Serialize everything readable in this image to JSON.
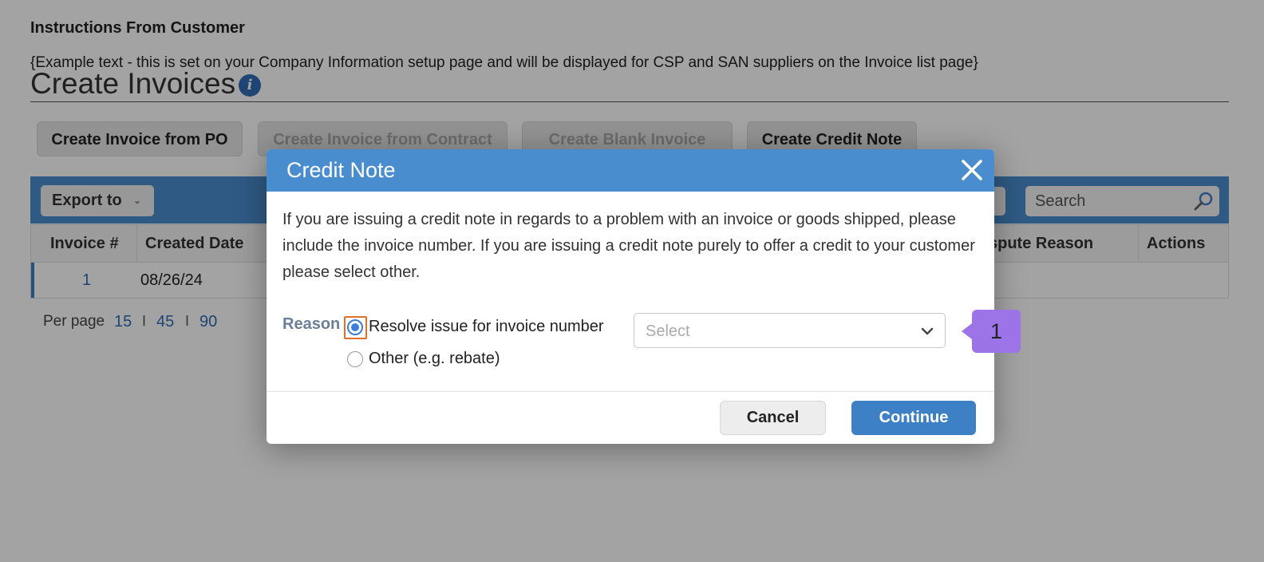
{
  "page": {
    "instructions_title": "Instructions From Customer",
    "instructions_text": "{Example text - this is set on your Company Information setup page and will be displayed for CSP and SAN suppliers on the Invoice list page}",
    "title": "Create Invoices",
    "info_icon_glyph": "i"
  },
  "toolbar": {
    "create_from_po": "Create Invoice from PO",
    "create_from_contract": "Create Invoice from Contract",
    "create_blank": "Create Blank Invoice",
    "create_credit_note": "Create Credit Note"
  },
  "table": {
    "export_label": "Export to",
    "search_placeholder": "Search",
    "columns": [
      "Invoice #",
      "Created Date",
      "spute Reason",
      "Actions"
    ],
    "rows": [
      {
        "invoice_no": "1",
        "created_date": "08/26/24"
      }
    ]
  },
  "pagination": {
    "label": "Per page",
    "options": [
      "15",
      "45",
      "90"
    ],
    "separator": "I"
  },
  "modal": {
    "title": "Credit Note",
    "description": "If you are issuing a credit note in regards to a problem with an invoice or goods shipped, please include the invoice number. If you are issuing a credit note purely to offer a credit to your customer please select other.",
    "reason_label": "Reason",
    "options": [
      {
        "label": "Resolve issue for invoice number",
        "checked": true
      },
      {
        "label": "Other (e.g. rebate)",
        "checked": false
      }
    ],
    "select_placeholder": "Select",
    "cancel_label": "Cancel",
    "continue_label": "Continue"
  },
  "callout": {
    "number": "1"
  },
  "colors": {
    "header_blue": "#4a8dcf",
    "primary_button": "#3e80c6",
    "link_blue": "#2f6db4",
    "callout_purple": "#9d74e8",
    "focus_orange": "#e3702a"
  }
}
